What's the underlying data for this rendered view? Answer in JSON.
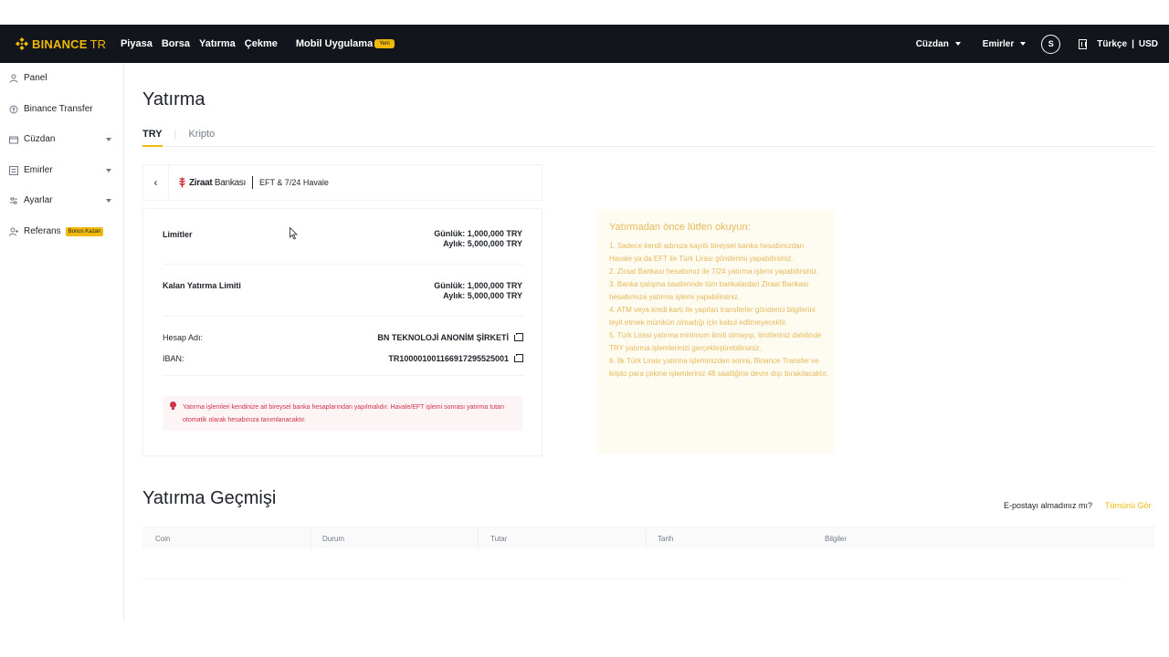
{
  "brand": {
    "name": "BINANCE",
    "suffix": "TR"
  },
  "nav": {
    "items": [
      "Piyasa",
      "Borsa",
      "Yatırma",
      "Çekme"
    ],
    "mobile": "Mobil Uygulama",
    "mobile_badge": "Yeni"
  },
  "topbar": {
    "wallet": "Cüzdan",
    "orders": "Emirler",
    "currency_icon": "S",
    "language": "Türkçe",
    "currency": "USD",
    "separator": "|"
  },
  "sidebar": {
    "items": [
      {
        "label": "Panel",
        "icon": "user-icon"
      },
      {
        "label": "Binance Transfer",
        "icon": "transfer-icon"
      },
      {
        "label": "Cüzdan",
        "icon": "wallet-icon"
      },
      {
        "label": "Emirler",
        "icon": "orders-icon"
      },
      {
        "label": "Ayarlar",
        "icon": "settings-icon"
      },
      {
        "label": "Referans",
        "icon": "referral-icon",
        "badge": "Bonus Kazan"
      }
    ]
  },
  "page": {
    "title": "Yatırma",
    "tabs": [
      "TRY",
      "Kripto"
    ],
    "tab_sep": "|"
  },
  "bank": {
    "name_bold": "Ziraat",
    "name_rest": "Bankası",
    "method": "EFT & 7/24 Havale",
    "back": "‹"
  },
  "limits": {
    "label": "Limitler",
    "daily": "Günlük: 1,000,000 TRY",
    "monthly": "Aylık: 5,000,000 TRY"
  },
  "remaining": {
    "label": "Kalan Yatırma Limiti",
    "daily": "Günlük: 1,000,000 TRY",
    "monthly": "Aylık: 5,000,000 TRY"
  },
  "account": {
    "name_label": "Hesap Adı:",
    "name_value": "BN TEKNOLOJİ ANONİM ŞİRKETİ",
    "iban_label": "IBAN:",
    "iban_value": "TR100001001166917295525001"
  },
  "warning": "Yatırma işlemleri kendinize ait bireysel banka hesaplarından yapılmalıdır. Havale/EFT işlemi sonrası yatırma tutarı otomatik olarak hesabınıza tanımlanacaktır.",
  "notice": {
    "title": "Yatırmadan önce lütfen okuyun:",
    "items": [
      "1. Sadece kendi adınıza kayıtlı bireysel banka hesabınızdan Havale ya da EFT ile Türk Lirası gönderimi yapabilirsiniz.",
      "2. Ziraat Bankası hesabımız ile 7/24 yatırma işlemi yapabilirsiniz.",
      "3. Banka çalışma saatlerinde tüm bankalardan Ziraat Bankası hesabımıza yatırma işlemi yapabilirsiniz.",
      "4. ATM veya kredi kartı ile yapılan transferler gönderici bilgilerini teyit etmek mümkün olmadığı için kabul edilmeyecektir.",
      "5. Türk Lirası yatırma minimum limiti olmayıp, limitleriniz dahilinde TRY yatırma işlemlerinizi gerçekleştirebilirsiniz.",
      "6. İlk Türk Lirası yatırma işleminizden sonra, Binance Transfer ve kripto para çekme işlemleriniz 48 saatliğine devre dışı bırakılacaktır."
    ]
  },
  "history": {
    "title": "Yatırma Geçmişi",
    "email_link": "E-postayı almadınız mı?",
    "all_link": "Tümünü Gör",
    "columns": [
      "Coin",
      "Durum",
      "Tutar",
      "Tarih",
      "Bilgiler"
    ]
  },
  "colors": {
    "brand": "#f0b90b",
    "topbar": "#12161c",
    "warning": "#cf304a",
    "notice_text": "#e6b95c"
  }
}
